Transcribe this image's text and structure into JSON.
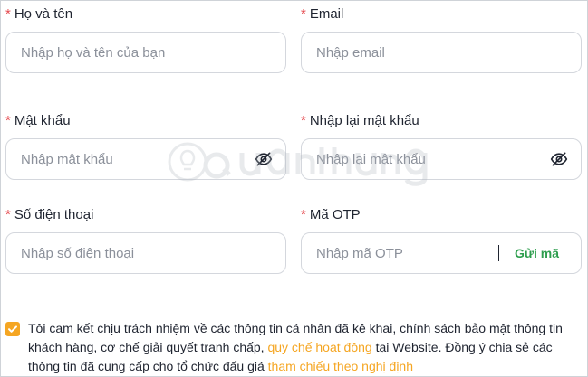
{
  "form": {
    "full_name": {
      "required_mark": "*",
      "label": "Họ và tên",
      "placeholder": "Nhập họ và tên của bạn",
      "value": ""
    },
    "email": {
      "required_mark": "*",
      "label": "Email",
      "placeholder": "Nhập email",
      "value": ""
    },
    "password": {
      "required_mark": "*",
      "label": "Mật khẩu",
      "placeholder": "Nhập mật khẩu",
      "value": "",
      "toggle_icon": "eye-off-icon"
    },
    "confirm_password": {
      "required_mark": "*",
      "label": "Nhập lại mật khẩu",
      "placeholder": "Nhập lại mật khẩu",
      "value": "",
      "toggle_icon": "eye-off-icon"
    },
    "phone": {
      "required_mark": "*",
      "label": "Số điện thoại",
      "placeholder": "Nhập số điện thoại",
      "value": ""
    },
    "otp": {
      "required_mark": "*",
      "label": "Mã OTP",
      "placeholder": "Nhập mã OTP",
      "value": "",
      "send_label": "Gửi mã"
    },
    "agreement": {
      "checked": true,
      "text_1": "Tôi cam kết chịu trách nhiệm về các thông tin cá nhân đã kê khai, chính sách bảo mật thông tin khách hàng, cơ chế giải quyết tranh chấp, ",
      "link_1": "quy chế hoạt động",
      "text_2": " tại Website. Đồng ý chia sẻ các thông tin đã cung cấp cho tổ chức đấu giá ",
      "link_2": "tham chiếu theo nghị định"
    }
  },
  "colors": {
    "required": "#e5484d",
    "accent_orange": "#f5a623",
    "send_green": "#2e9e4e",
    "input_border": "#d4d7dd",
    "placeholder": "#8b909a"
  }
}
